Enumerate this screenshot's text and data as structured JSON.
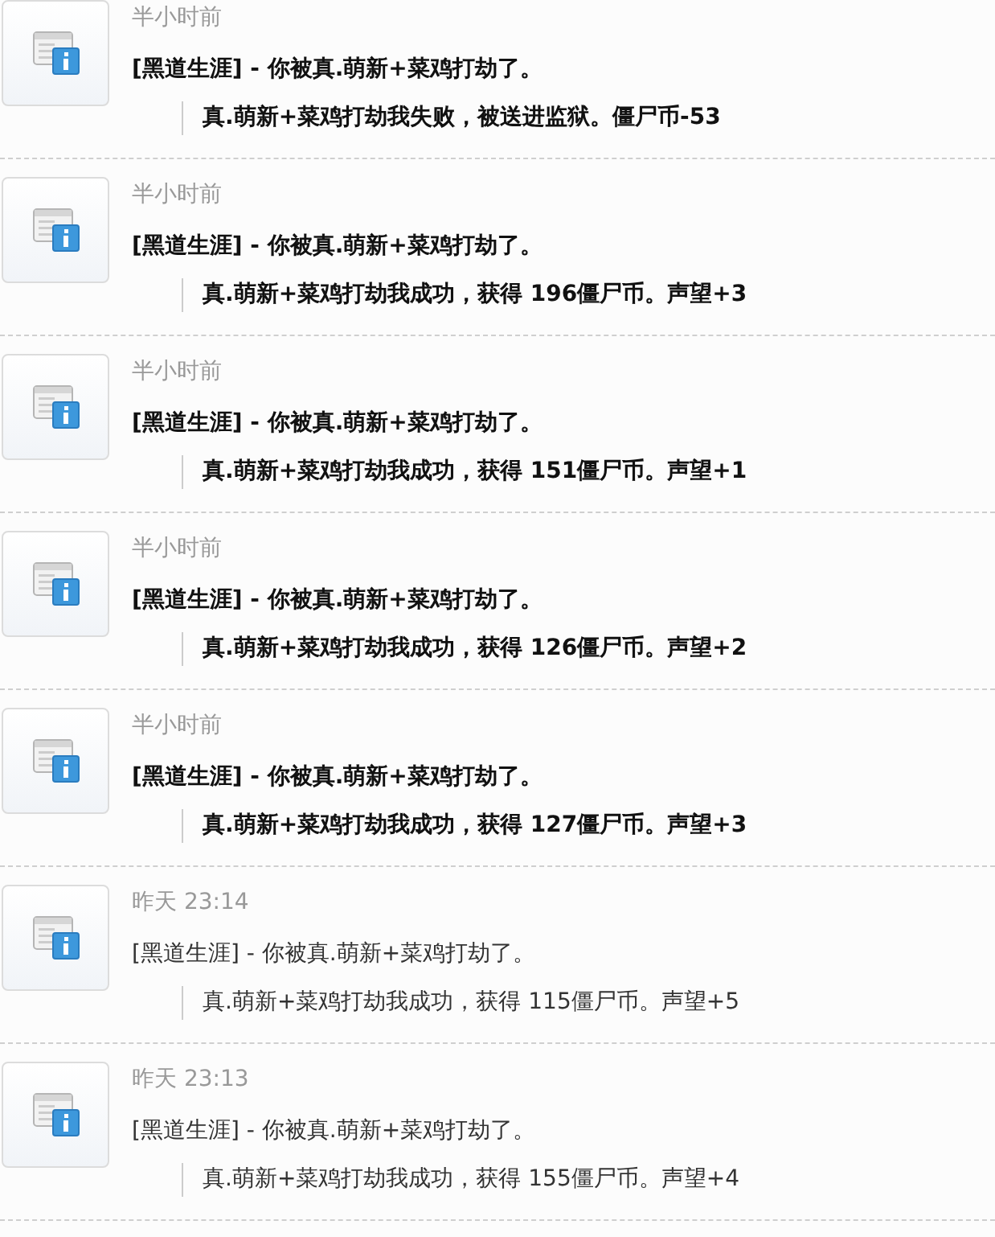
{
  "notifications": [
    {
      "time": "半小时前",
      "title": "[黑道生涯] - 你被真.萌新+菜鸡打劫了。",
      "detail": "真.萌新+菜鸡打劫我失败，被送进监狱。僵尸币-53",
      "unread": true
    },
    {
      "time": "半小时前",
      "title": "[黑道生涯] - 你被真.萌新+菜鸡打劫了。",
      "detail": "真.萌新+菜鸡打劫我成功，获得 196僵尸币。声望+3",
      "unread": true
    },
    {
      "time": "半小时前",
      "title": "[黑道生涯] - 你被真.萌新+菜鸡打劫了。",
      "detail": "真.萌新+菜鸡打劫我成功，获得 151僵尸币。声望+1",
      "unread": true
    },
    {
      "time": "半小时前",
      "title": "[黑道生涯] - 你被真.萌新+菜鸡打劫了。",
      "detail": "真.萌新+菜鸡打劫我成功，获得 126僵尸币。声望+2",
      "unread": true
    },
    {
      "time": "半小时前",
      "title": "[黑道生涯] - 你被真.萌新+菜鸡打劫了。",
      "detail": "真.萌新+菜鸡打劫我成功，获得 127僵尸币。声望+3",
      "unread": true
    },
    {
      "time": "昨天 23:14",
      "title": "[黑道生涯] - 你被真.萌新+菜鸡打劫了。",
      "detail": "真.萌新+菜鸡打劫我成功，获得 115僵尸币。声望+5",
      "unread": false
    },
    {
      "time": "昨天 23:13",
      "title": "[黑道生涯] - 你被真.萌新+菜鸡打劫了。",
      "detail": "真.萌新+菜鸡打劫我成功，获得 155僵尸币。声望+4",
      "unread": false
    }
  ]
}
